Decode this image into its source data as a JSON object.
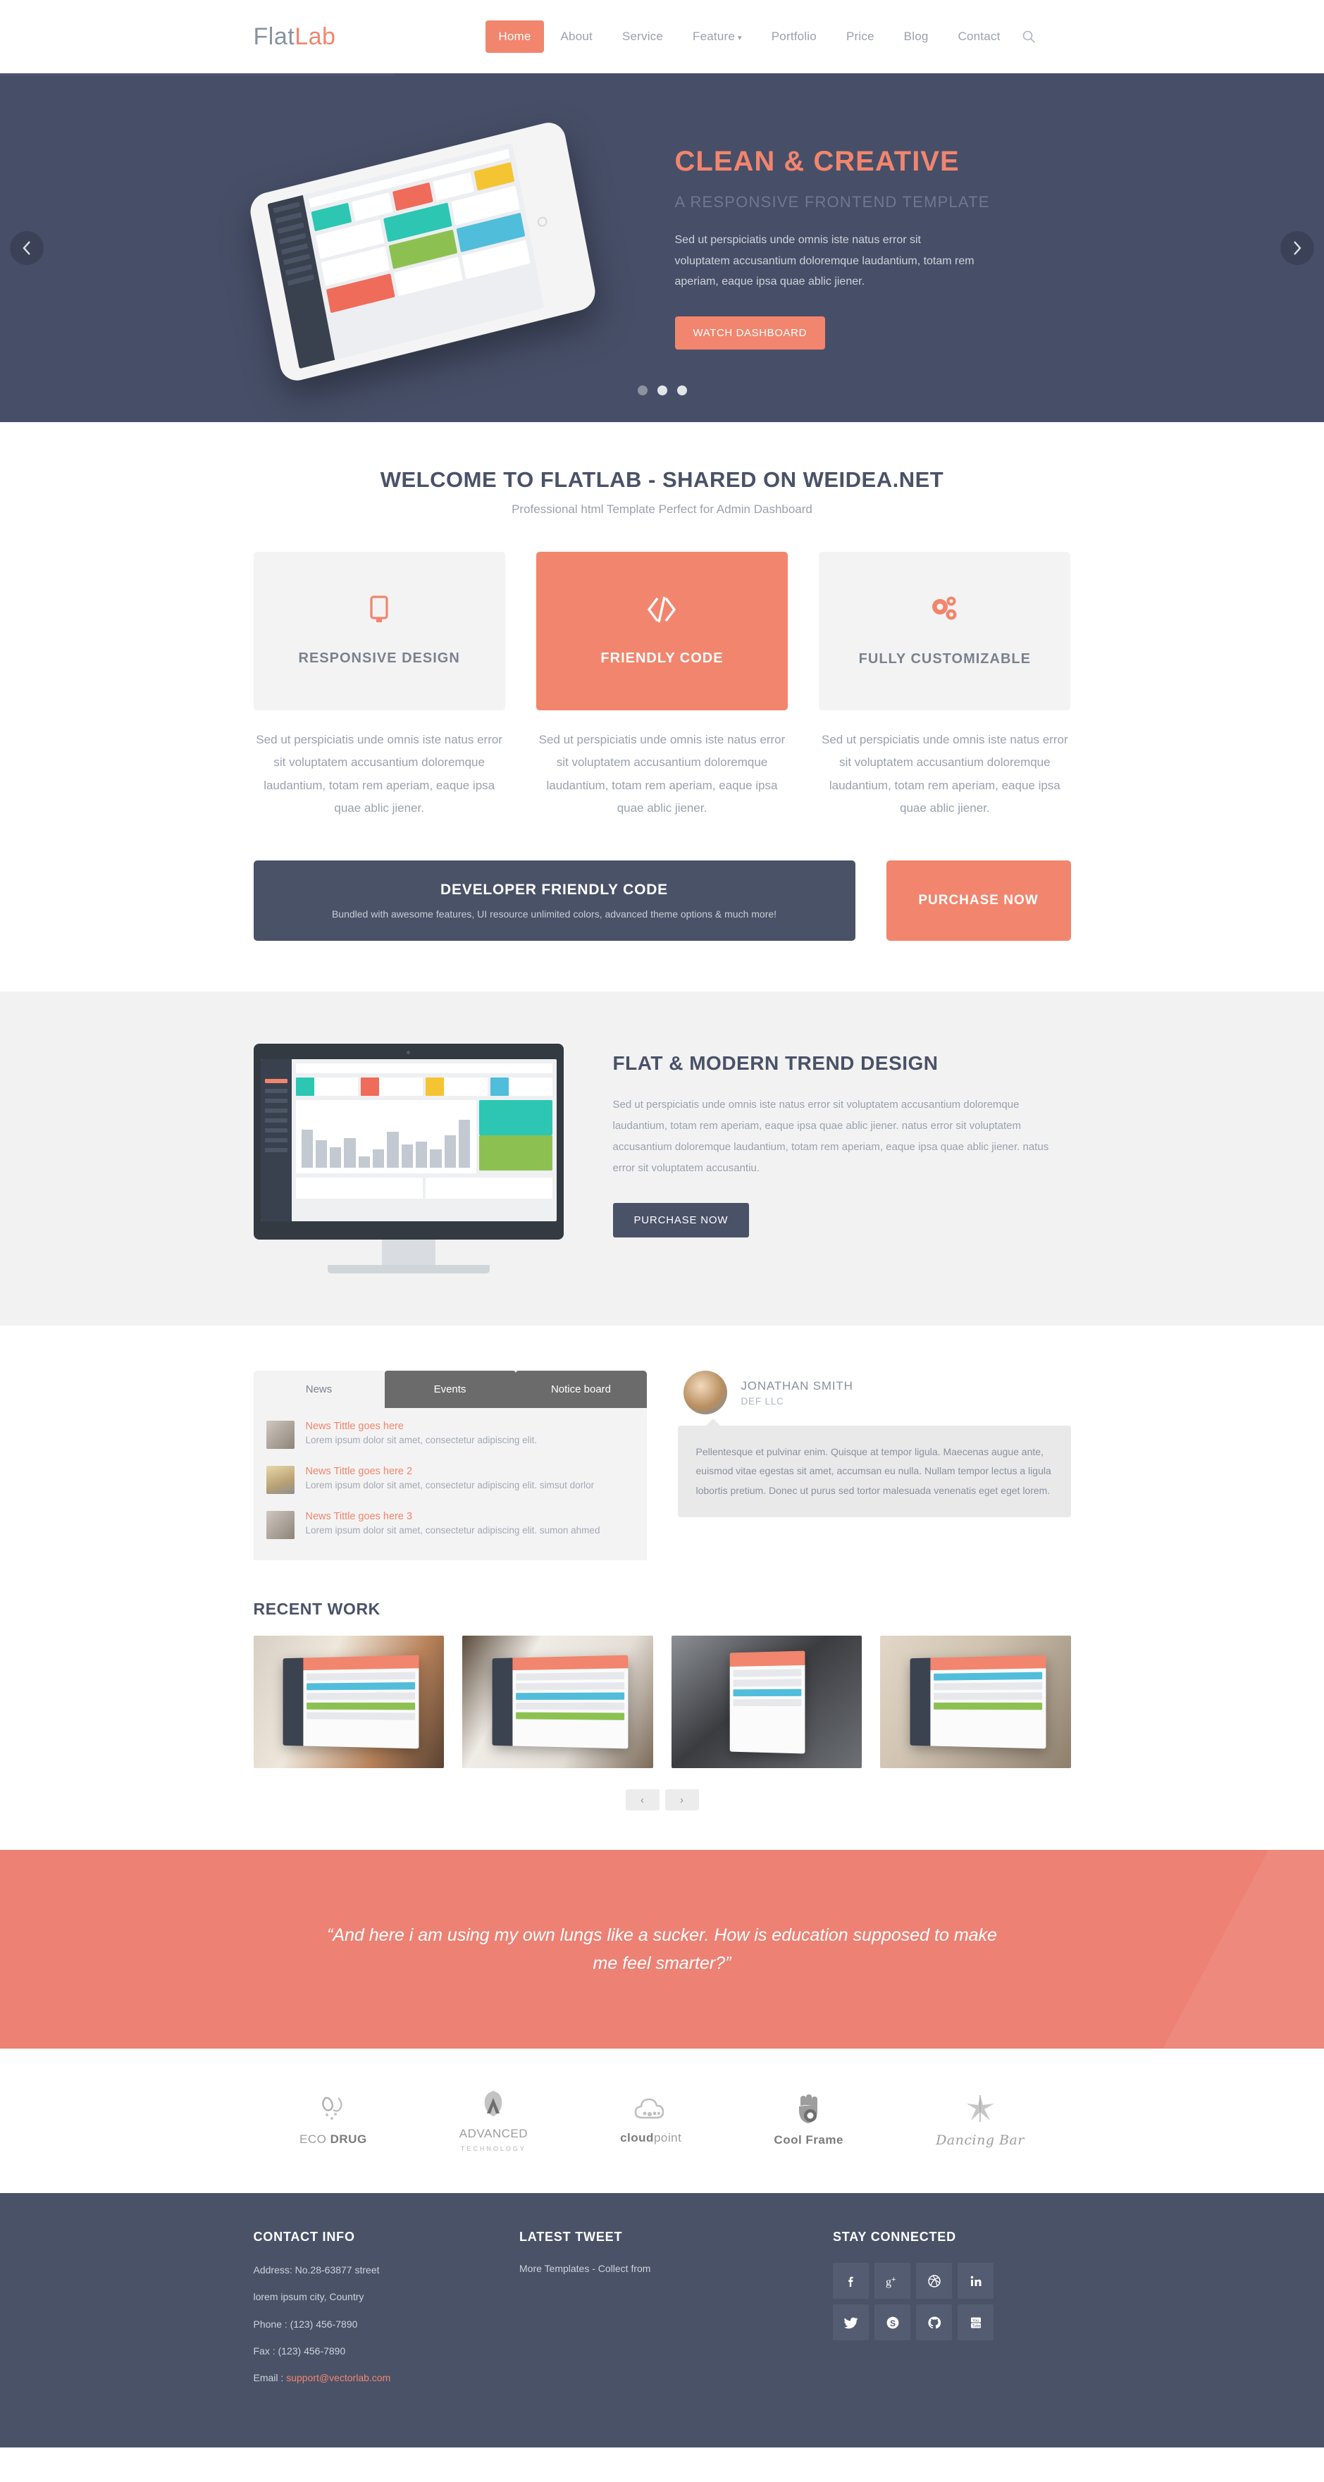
{
  "header": {
    "logo_flat": "Flat",
    "logo_lab": "Lab",
    "nav": [
      {
        "label": "Home",
        "active": true
      },
      {
        "label": "About",
        "active": false
      },
      {
        "label": "Service",
        "active": false
      },
      {
        "label": "Feature",
        "active": false,
        "caret": "⌄"
      },
      {
        "label": "Portfolio",
        "active": false
      },
      {
        "label": "Price",
        "active": false
      },
      {
        "label": "Blog",
        "active": false
      },
      {
        "label": "Contact",
        "active": false
      }
    ],
    "search_icon": "search-icon"
  },
  "hero": {
    "title": "CLEAN & CREATIVE",
    "subtitle": "A RESPONSIVE FRONTEND TEMPLATE",
    "text": "Sed ut perspiciatis unde omnis iste natus error sit voluptatem accusantium doloremque laudantium, totam rem aperiam, eaque ipsa quae ablic jiener.",
    "button": "WATCH DASHBOARD",
    "prev_arrow": "‹",
    "next_arrow": "›",
    "slide_count": 3,
    "active_slide": 1,
    "accent_color": "#f2856d",
    "background_color": "#474f68"
  },
  "welcome": {
    "title": "WELCOME TO FLATLAB - SHARED ON WEIDEA.NET",
    "subtitle": "Professional html Template Perfect for Admin Dashboard",
    "features": [
      {
        "icon": "monitor-icon",
        "glyph": "⎕",
        "title": "RESPONSIVE DESIGN",
        "desc": "Sed ut perspiciatis unde omnis iste natus error sit voluptatem accusantium doloremque laudantium, totam rem aperiam, eaque ipsa quae ablic jiener.",
        "highlighted": false
      },
      {
        "icon": "code-icon",
        "glyph": "〈/〉",
        "title": "FRIENDLY CODE",
        "desc": "Sed ut perspiciatis unde omnis iste natus error sit voluptatem accusantium doloremque laudantium, totam rem aperiam, eaque ipsa quae ablic jiener.",
        "highlighted": true
      },
      {
        "icon": "gears-icon",
        "glyph": "⚙",
        "title": "FULLY CUSTOMIZABLE",
        "desc": "Sed ut perspiciatis unde omnis iste natus error sit voluptatem accusantium doloremque laudantium, totam rem aperiam, eaque ipsa quae ablic jiener.",
        "highlighted": false
      }
    ]
  },
  "cta": {
    "title": "DEVELOPER FRIENDLY CODE",
    "subtitle": "Bundled with awesome features, UI resource unlimited colors, advanced theme options & much more!",
    "button": "PURCHASE NOW"
  },
  "flatmodern": {
    "title": "FLAT & MODERN TREND DESIGN",
    "text": "Sed ut perspiciatis unde omnis iste natus error sit voluptatem accusantium doloremque laudantium, totam rem aperiam, eaque ipsa quae ablic jiener. natus error sit voluptatem accusantium doloremque laudantium, totam rem aperiam, eaque ipsa quae ablic jiener. natus error sit voluptatem accusantiu.",
    "button": "PURCHASE NOW"
  },
  "newsbox": {
    "tabs": [
      {
        "label": "News",
        "active": true
      },
      {
        "label": "Events",
        "active": false
      },
      {
        "label": "Notice board",
        "active": false
      }
    ],
    "items": [
      {
        "title": "News Tittle goes here",
        "desc": "Lorem ipsum dolor sit amet, consectetur adipiscing elit."
      },
      {
        "title": "News Tittle goes here 2",
        "desc": "Lorem ipsum dolor sit amet, consectetur adipiscing elit. simsut dorlor"
      },
      {
        "title": "News Tittle goes here 3",
        "desc": "Lorem ipsum dolor sit amet, consectetur adipiscing elit. sumon ahmed"
      }
    ]
  },
  "testimonial": {
    "name": "JONATHAN SMITH",
    "role": "DEF LLC",
    "quote": "Pellentesque et pulvinar enim. Quisque at tempor ligula. Maecenas augue ante, euismod vitae egestas sit amet, accumsan eu nulla. Nullam tempor lectus a ligula lobortis pretium. Donec ut purus sed tortor malesuada venenatis eget eget lorem."
  },
  "recent_work": {
    "title": "RECENT WORK",
    "items": [
      {
        "name": "laptop-dashboard-work"
      },
      {
        "name": "laptop-profile-work"
      },
      {
        "name": "phone-profile-work"
      },
      {
        "name": "tablet-dashboard-work"
      }
    ],
    "prev_arrow": "‹",
    "next_arrow": "›"
  },
  "quote_banner": {
    "text": "“And here i am using my own lungs like a sucker. How is education supposed to make me feel smarter?”",
    "background_color": "#ec8174"
  },
  "clients": [
    {
      "glyph": "⚗",
      "name": "ECO DRUG",
      "name_plain": "ECO ",
      "name_bold": "DRUG",
      "sub": "",
      "icon": "eco-drug-logo"
    },
    {
      "glyph": "▲",
      "name": "ADVANCED",
      "name_plain": "ADVANCED",
      "name_bold": "",
      "sub": "TECHNOLOGY",
      "icon": "advanced-technology-logo"
    },
    {
      "glyph": "☁",
      "name": "cloudpoint",
      "name_plain": "cloud",
      "name_bold": "point",
      "sub": "",
      "icon": "cloudpoint-logo"
    },
    {
      "glyph": "✋",
      "name": "Cool Frame",
      "name_plain": "Cool Frame",
      "name_bold": "",
      "sub": "",
      "icon": "cool-frame-logo"
    },
    {
      "glyph": "✦",
      "name": "Dancing Bar",
      "name_plain": "Dancing Bar",
      "name_bold": "",
      "sub": "",
      "icon": "dancing-bar-logo"
    }
  ],
  "footer": {
    "contact": {
      "heading": "CONTACT INFO",
      "address1": "Address: No.28-63877 street",
      "address2": "lorem ipsum city, Country",
      "phone": "Phone : (123) 456-7890",
      "fax": "Fax : (123) 456-7890",
      "email_label": "Email : ",
      "email": "support@vectorlab.com"
    },
    "tweet": {
      "heading": "LATEST TWEET",
      "text": "More Templates  - Collect from"
    },
    "social": {
      "heading": "STAY CONNECTED",
      "items": [
        {
          "name": "facebook-icon",
          "glyph": "f"
        },
        {
          "name": "google-plus-icon",
          "glyph": "g⁺"
        },
        {
          "name": "dribbble-icon",
          "glyph": "⊛"
        },
        {
          "name": "linkedin-icon",
          "glyph": "in"
        },
        {
          "name": "twitter-icon",
          "glyph": "ᵗ"
        },
        {
          "name": "skype-icon",
          "glyph": "S"
        },
        {
          "name": "github-icon",
          "glyph": "○"
        },
        {
          "name": "youtube-icon",
          "glyph": "▶"
        }
      ]
    }
  }
}
